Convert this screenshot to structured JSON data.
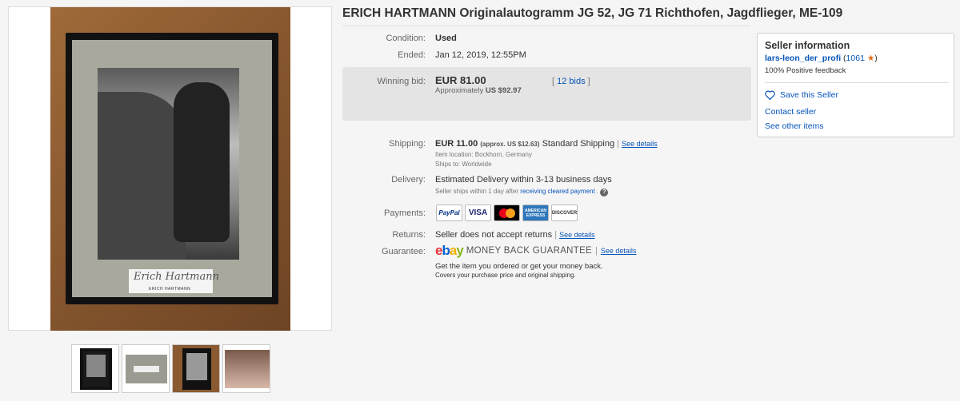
{
  "title": "ERICH HARTMANN Originalautogramm JG 52, JG 71 Richthofen, Jagdflieger, ME-109",
  "photo": {
    "signature": "Erich Hartmann",
    "signature_caption": "ERICH HARTMANN"
  },
  "thumbnails": [
    "thumb-1",
    "thumb-2",
    "thumb-3",
    "thumb-4"
  ],
  "condition": {
    "label": "Condition:",
    "value": "Used"
  },
  "ended": {
    "label": "Ended:",
    "value": "Jan 12, 2019, 12:55PM"
  },
  "bid": {
    "label": "Winning bid:",
    "price": "EUR 81.00",
    "approx_prefix": "Approximately",
    "approx_value": "US $92.97",
    "bids_open": "[",
    "bids_link": "12 bids",
    "bids_close": "]"
  },
  "shipping": {
    "label": "Shipping:",
    "price": "EUR 11.00",
    "approx": "(approx. US $12.63)",
    "method": "Standard Shipping",
    "sep": "|",
    "details": "See details",
    "location": "Item location:  Bockhorn, Germany",
    "ships_to": "Ships to:  Worldwide"
  },
  "delivery": {
    "label": "Delivery:",
    "value": "Estimated Delivery within 3-13 business days",
    "note_prefix": "Seller ships within 1 day after",
    "note_link": "receiving cleared payment",
    "note_suffix": ".",
    "help": "?"
  },
  "payments": {
    "label": "Payments:",
    "methods": [
      "PayPal",
      "VISA",
      "MasterCard",
      "AMERICAN EXPRESS",
      "DISCOVER"
    ]
  },
  "returns": {
    "label": "Returns:",
    "value": "Seller does not accept returns",
    "sep": "|",
    "details": "See details"
  },
  "guarantee": {
    "label": "Guarantee:",
    "logo": [
      "e",
      "b",
      "a",
      "y"
    ],
    "text": "MONEY BACK GUARANTEE",
    "sep": "|",
    "details": "See details",
    "line1": "Get the item you ordered or get your money back.",
    "line2": "Covers your purchase price and original shipping."
  },
  "seller": {
    "heading": "Seller information",
    "name": "lars-leon_der_profi",
    "score_open": "(",
    "score": "1061",
    "score_close": ")",
    "feedback": "100% Positive feedback",
    "save": "Save this Seller",
    "contact": "Contact seller",
    "other": "See other items"
  },
  "colors": {
    "link": "#0654ba",
    "star": "#e46a14",
    "bid_box": "#e4e4e4"
  }
}
